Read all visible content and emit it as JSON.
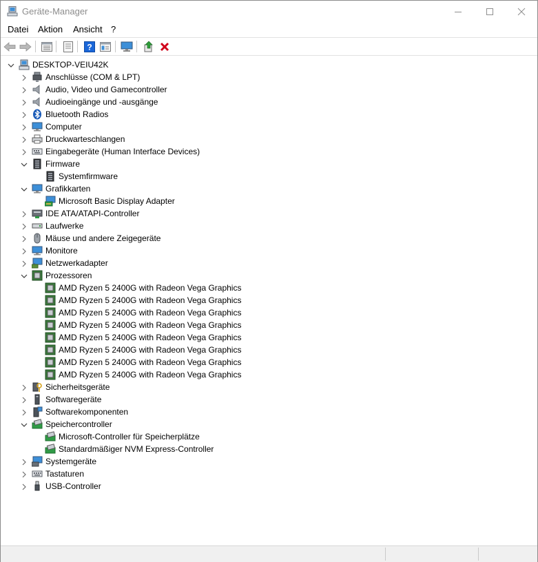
{
  "window": {
    "title": "Geräte-Manager"
  },
  "menu": [
    "Datei",
    "Aktion",
    "Ansicht",
    "?"
  ],
  "toolbar": {
    "buttons": [
      "back-arrow-icon",
      "forward-arrow-icon",
      "properties-list-icon",
      "document-icon",
      "help-icon",
      "view-details-icon",
      "scan-monitor-icon",
      "update-driver-icon",
      "uninstall-x-icon"
    ],
    "accent": "#1a66d8",
    "delete_color": "#d0021b"
  },
  "tree": [
    {
      "depth": 0,
      "expander": "expanded",
      "icon": "computer-root",
      "label": "DESKTOP-VEIU42K"
    },
    {
      "depth": 1,
      "expander": "collapsed",
      "icon": "port",
      "label": "Anschlüsse (COM & LPT)"
    },
    {
      "depth": 1,
      "expander": "collapsed",
      "icon": "speaker",
      "label": "Audio, Video und Gamecontroller"
    },
    {
      "depth": 1,
      "expander": "collapsed",
      "icon": "speaker",
      "label": "Audioeingänge und -ausgänge"
    },
    {
      "depth": 1,
      "expander": "collapsed",
      "icon": "bluetooth",
      "label": "Bluetooth Radios"
    },
    {
      "depth": 1,
      "expander": "collapsed",
      "icon": "monitor",
      "label": "Computer"
    },
    {
      "depth": 1,
      "expander": "collapsed",
      "icon": "printer",
      "label": "Druckwarteschlangen"
    },
    {
      "depth": 1,
      "expander": "collapsed",
      "icon": "keyboard-hid",
      "label": "Eingabegeräte (Human Interface Devices)"
    },
    {
      "depth": 1,
      "expander": "expanded",
      "icon": "firmware",
      "label": "Firmware"
    },
    {
      "depth": 2,
      "expander": "none",
      "icon": "firmware",
      "label": "Systemfirmware"
    },
    {
      "depth": 1,
      "expander": "expanded",
      "icon": "display",
      "label": "Grafikkarten"
    },
    {
      "depth": 2,
      "expander": "none",
      "icon": "display-adapter",
      "label": "Microsoft Basic Display Adapter"
    },
    {
      "depth": 1,
      "expander": "collapsed",
      "icon": "ide",
      "label": "IDE ATA/ATAPI-Controller"
    },
    {
      "depth": 1,
      "expander": "collapsed",
      "icon": "drive",
      "label": "Laufwerke"
    },
    {
      "depth": 1,
      "expander": "collapsed",
      "icon": "mouse",
      "label": "Mäuse und andere Zeigegeräte"
    },
    {
      "depth": 1,
      "expander": "collapsed",
      "icon": "monitor",
      "label": "Monitore"
    },
    {
      "depth": 1,
      "expander": "collapsed",
      "icon": "network",
      "label": "Netzwerkadapter"
    },
    {
      "depth": 1,
      "expander": "expanded",
      "icon": "cpu",
      "label": "Prozessoren"
    },
    {
      "depth": 2,
      "expander": "none",
      "icon": "cpu",
      "label": "AMD Ryzen 5 2400G with Radeon Vega Graphics"
    },
    {
      "depth": 2,
      "expander": "none",
      "icon": "cpu",
      "label": "AMD Ryzen 5 2400G with Radeon Vega Graphics"
    },
    {
      "depth": 2,
      "expander": "none",
      "icon": "cpu",
      "label": "AMD Ryzen 5 2400G with Radeon Vega Graphics"
    },
    {
      "depth": 2,
      "expander": "none",
      "icon": "cpu",
      "label": "AMD Ryzen 5 2400G with Radeon Vega Graphics"
    },
    {
      "depth": 2,
      "expander": "none",
      "icon": "cpu",
      "label": "AMD Ryzen 5 2400G with Radeon Vega Graphics"
    },
    {
      "depth": 2,
      "expander": "none",
      "icon": "cpu",
      "label": "AMD Ryzen 5 2400G with Radeon Vega Graphics"
    },
    {
      "depth": 2,
      "expander": "none",
      "icon": "cpu",
      "label": "AMD Ryzen 5 2400G with Radeon Vega Graphics"
    },
    {
      "depth": 2,
      "expander": "none",
      "icon": "cpu",
      "label": "AMD Ryzen 5 2400G with Radeon Vega Graphics"
    },
    {
      "depth": 1,
      "expander": "collapsed",
      "icon": "security",
      "label": "Sicherheitsgeräte"
    },
    {
      "depth": 1,
      "expander": "collapsed",
      "icon": "software-device",
      "label": "Softwaregeräte"
    },
    {
      "depth": 1,
      "expander": "collapsed",
      "icon": "software-component",
      "label": "Softwarekomponenten"
    },
    {
      "depth": 1,
      "expander": "expanded",
      "icon": "storage",
      "label": "Speichercontroller"
    },
    {
      "depth": 2,
      "expander": "none",
      "icon": "storage",
      "label": "Microsoft-Controller für Speicherplätze"
    },
    {
      "depth": 2,
      "expander": "none",
      "icon": "storage",
      "label": "Standardmäßiger NVM Express-Controller"
    },
    {
      "depth": 1,
      "expander": "collapsed",
      "icon": "system",
      "label": "Systemgeräte"
    },
    {
      "depth": 1,
      "expander": "collapsed",
      "icon": "keyboard",
      "label": "Tastaturen"
    },
    {
      "depth": 1,
      "expander": "collapsed",
      "icon": "usb",
      "label": "USB-Controller"
    }
  ]
}
